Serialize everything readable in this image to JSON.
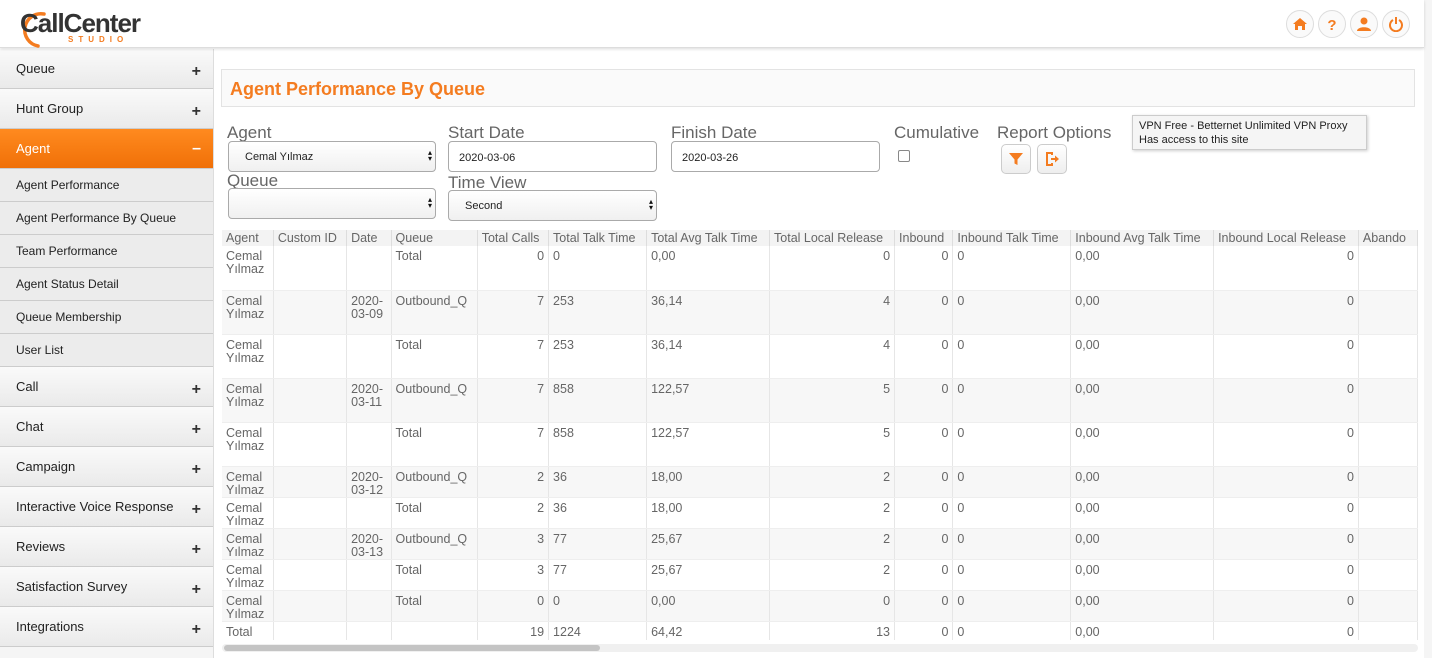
{
  "app": {
    "logo_main": "CallCenter",
    "logo_sub": "STUDIO",
    "brand_color": "#f47c20"
  },
  "header_icons": [
    "home-icon",
    "help-icon",
    "user-icon",
    "power-icon"
  ],
  "sidebar": {
    "items": [
      {
        "label": "Queue",
        "expander": "+"
      },
      {
        "label": "Hunt Group",
        "expander": "+"
      },
      {
        "label": "Agent",
        "expander": "–",
        "active": true
      },
      {
        "label": "Call",
        "expander": "+"
      },
      {
        "label": "Chat",
        "expander": "+"
      },
      {
        "label": "Campaign",
        "expander": "+"
      },
      {
        "label": "Interactive Voice Response",
        "expander": "+"
      },
      {
        "label": "Reviews",
        "expander": "+"
      },
      {
        "label": "Satisfaction Survey",
        "expander": "+"
      },
      {
        "label": "Integrations",
        "expander": "+"
      }
    ],
    "agent_subitems": [
      "Agent Performance",
      "Agent Performance By Queue",
      "Team Performance",
      "Agent Status Detail",
      "Queue Membership",
      "User List"
    ]
  },
  "page": {
    "title": "Agent Performance By Queue"
  },
  "filters": {
    "agent_label": "Agent",
    "agent_value": "Cemal Yılmaz",
    "start_label": "Start Date",
    "start_value": "2020-03-06",
    "finish_label": "Finish Date",
    "finish_value": "2020-03-26",
    "cumulative_label": "Cumulative",
    "report_options_label": "Report Options",
    "queue_label": "Queue",
    "queue_value": "",
    "timeview_label": "Time View",
    "timeview_value": "Second"
  },
  "tooltip": {
    "line1": "VPN Free - Betternet Unlimited VPN Proxy",
    "line2": "Has access to this site"
  },
  "table": {
    "columns": [
      "Agent",
      "Custom ID",
      "Date",
      "Queue",
      "Total Calls",
      "Total Talk Time",
      "Total Avg Talk Time",
      "Total Local Release",
      "Inbound",
      "Inbound Talk Time",
      "Inbound Avg Talk Time",
      "Inbound Local Release",
      "Abando"
    ],
    "rows": [
      {
        "agent": "Cemal Yılmaz",
        "custom_id": "",
        "date": "",
        "queue": "Total",
        "total_calls": "0",
        "total_talk": "0",
        "total_avg": "0,00",
        "total_local": "0",
        "inbound": "0",
        "in_talk": "0",
        "in_avg": "0,00",
        "in_local": "0",
        "size": "tall"
      },
      {
        "agent": "Cemal Yılmaz",
        "custom_id": "",
        "date": "2020-03-09",
        "queue": "Outbound_Q",
        "total_calls": "7",
        "total_talk": "253",
        "total_avg": "36,14",
        "total_local": "4",
        "inbound": "0",
        "in_talk": "0",
        "in_avg": "0,00",
        "in_local": "0",
        "size": "tall"
      },
      {
        "agent": "Cemal Yılmaz",
        "custom_id": "",
        "date": "",
        "queue": "Total",
        "total_calls": "7",
        "total_talk": "253",
        "total_avg": "36,14",
        "total_local": "4",
        "inbound": "0",
        "in_talk": "0",
        "in_avg": "0,00",
        "in_local": "0",
        "size": "tall"
      },
      {
        "agent": "Cemal Yılmaz",
        "custom_id": "",
        "date": "2020-03-11",
        "queue": "Outbound_Q",
        "total_calls": "7",
        "total_talk": "858",
        "total_avg": "122,57",
        "total_local": "5",
        "inbound": "0",
        "in_talk": "0",
        "in_avg": "0,00",
        "in_local": "0",
        "size": "tall"
      },
      {
        "agent": "Cemal Yılmaz",
        "custom_id": "",
        "date": "",
        "queue": "Total",
        "total_calls": "7",
        "total_talk": "858",
        "total_avg": "122,57",
        "total_local": "5",
        "inbound": "0",
        "in_talk": "0",
        "in_avg": "0,00",
        "in_local": "0",
        "size": "tall"
      },
      {
        "agent": "Cemal Yılmaz",
        "custom_id": "",
        "date": "2020-03-12",
        "queue": "Outbound_Q",
        "total_calls": "2",
        "total_talk": "36",
        "total_avg": "18,00",
        "total_local": "2",
        "inbound": "0",
        "in_talk": "0",
        "in_avg": "0,00",
        "in_local": "0",
        "size": "short"
      },
      {
        "agent": "Cemal Yılmaz",
        "custom_id": "",
        "date": "",
        "queue": "Total",
        "total_calls": "2",
        "total_talk": "36",
        "total_avg": "18,00",
        "total_local": "2",
        "inbound": "0",
        "in_talk": "0",
        "in_avg": "0,00",
        "in_local": "0",
        "size": "short"
      },
      {
        "agent": "Cemal Yılmaz",
        "custom_id": "",
        "date": "2020-03-13",
        "queue": "Outbound_Q",
        "total_calls": "3",
        "total_talk": "77",
        "total_avg": "25,67",
        "total_local": "2",
        "inbound": "0",
        "in_talk": "0",
        "in_avg": "0,00",
        "in_local": "0",
        "size": "short"
      },
      {
        "agent": "Cemal Yılmaz",
        "custom_id": "",
        "date": "",
        "queue": "Total",
        "total_calls": "3",
        "total_talk": "77",
        "total_avg": "25,67",
        "total_local": "2",
        "inbound": "0",
        "in_talk": "0",
        "in_avg": "0,00",
        "in_local": "0",
        "size": "short"
      },
      {
        "agent": "Cemal Yılmaz",
        "custom_id": "",
        "date": "",
        "queue": "Total",
        "total_calls": "0",
        "total_talk": "0",
        "total_avg": "0,00",
        "total_local": "0",
        "inbound": "0",
        "in_talk": "0",
        "in_avg": "0,00",
        "in_local": "0",
        "size": "short"
      },
      {
        "agent": "Total",
        "custom_id": "",
        "date": "",
        "queue": "",
        "total_calls": "19",
        "total_talk": "1224",
        "total_avg": "64,42",
        "total_local": "13",
        "inbound": "0",
        "in_talk": "0",
        "in_avg": "0,00",
        "in_local": "0",
        "size": "last"
      }
    ]
  }
}
